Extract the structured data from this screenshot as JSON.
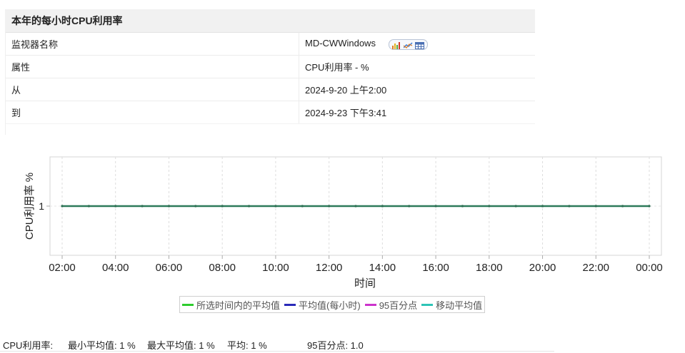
{
  "report": {
    "title": "本年的每小时CPU利用率",
    "rows": [
      {
        "label": "监视器名称",
        "value": "MD-CWWindows"
      },
      {
        "label": "属性",
        "value": "CPU利用率 - %"
      },
      {
        "label": "从",
        "value": "2024-9-20 上午2:00"
      },
      {
        "label": "到",
        "value": "2024-9-23 下午3:41"
      }
    ],
    "view_icons": [
      "bar-chart-icon",
      "line-chart-icon",
      "table-icon"
    ]
  },
  "chart_data": {
    "type": "line",
    "xlabel": "时间",
    "ylabel": "CPU利用率 %",
    "x_ticks": [
      "02:00",
      "04:00",
      "06:00",
      "08:00",
      "10:00",
      "12:00",
      "14:00",
      "16:00",
      "18:00",
      "20:00",
      "22:00",
      "00:00"
    ],
    "y_ticks": [
      1
    ],
    "grid": true,
    "series": [
      {
        "name": "所选时间内的平均值",
        "color": "#2ecc2e",
        "x": [
          "02:00",
          "03:00",
          "04:00",
          "05:00",
          "06:00",
          "07:00",
          "08:00",
          "09:00",
          "10:00",
          "11:00",
          "12:00",
          "13:00",
          "14:00",
          "15:00",
          "16:00",
          "17:00",
          "18:00",
          "19:00",
          "20:00",
          "21:00",
          "22:00",
          "23:00",
          "00:00"
        ],
        "values": [
          1,
          1,
          1,
          1,
          1,
          1,
          1,
          1,
          1,
          1,
          1,
          1,
          1,
          1,
          1,
          1,
          1,
          1,
          1,
          1,
          1,
          1,
          1
        ]
      },
      {
        "name": "平均值(每小时)",
        "color": "#2a2ab8",
        "x": [
          "02:00",
          "03:00",
          "04:00",
          "05:00",
          "06:00",
          "07:00",
          "08:00",
          "09:00",
          "10:00",
          "11:00",
          "12:00",
          "13:00",
          "14:00",
          "15:00",
          "16:00",
          "17:00",
          "18:00",
          "19:00",
          "20:00",
          "21:00",
          "22:00",
          "23:00",
          "00:00"
        ],
        "values": [
          1,
          1,
          1,
          1,
          1,
          1,
          1,
          1,
          1,
          1,
          1,
          1,
          1,
          1,
          1,
          1,
          1,
          1,
          1,
          1,
          1,
          1,
          1
        ]
      },
      {
        "name": "95百分点",
        "color": "#cc33cc",
        "x": [
          "02:00",
          "03:00",
          "04:00",
          "05:00",
          "06:00",
          "07:00",
          "08:00",
          "09:00",
          "10:00",
          "11:00",
          "12:00",
          "13:00",
          "14:00",
          "15:00",
          "16:00",
          "17:00",
          "18:00",
          "19:00",
          "20:00",
          "21:00",
          "22:00",
          "23:00",
          "00:00"
        ],
        "values": [
          1,
          1,
          1,
          1,
          1,
          1,
          1,
          1,
          1,
          1,
          1,
          1,
          1,
          1,
          1,
          1,
          1,
          1,
          1,
          1,
          1,
          1,
          1
        ]
      },
      {
        "name": "移动平均值",
        "color": "#2ec4b6",
        "x": [
          "02:00",
          "03:00",
          "04:00",
          "05:00",
          "06:00",
          "07:00",
          "08:00",
          "09:00",
          "10:00",
          "11:00",
          "12:00",
          "13:00",
          "14:00",
          "15:00",
          "16:00",
          "17:00",
          "18:00",
          "19:00",
          "20:00",
          "21:00",
          "22:00",
          "23:00",
          "00:00"
        ],
        "values": [
          1,
          1,
          1,
          1,
          1,
          1,
          1,
          1,
          1,
          1,
          1,
          1,
          1,
          1,
          1,
          1,
          1,
          1,
          1,
          1,
          1,
          1,
          1
        ]
      }
    ]
  },
  "summary": {
    "prefix": "CPU利用率:",
    "min_avg": "最小平均值:  1  %",
    "max_avg": "最大平均值:  1  %",
    "avg": "平均:  1  %",
    "p95": "95百分点:  1.0"
  }
}
